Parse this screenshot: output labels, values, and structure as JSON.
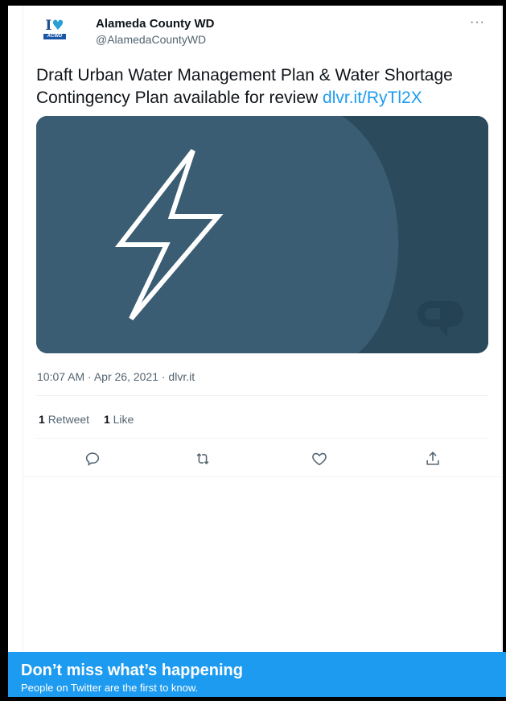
{
  "account": {
    "display_name": "Alameda County WD",
    "handle": "@AlamedaCountyWD",
    "avatar_text": "I",
    "avatar_bar_text": "ACWD"
  },
  "tweet": {
    "text": "Draft Urban Water Management Plan & Water Shortage Contingency Plan available for review ",
    "link": "dlvr.it/RyTl2X",
    "media_icon": "lightning-bolt-icon",
    "media_watermark": "link-preview-logo-icon",
    "timestamp": "10:07 AM · Apr 26, 2021 · dlvr.it"
  },
  "stats": {
    "retweets_count": "1",
    "retweets_label": "Retweet",
    "likes_count": "1",
    "likes_label": "Like"
  },
  "actions": {
    "reply_icon": "reply-icon",
    "retweet_icon": "retweet-icon",
    "like_icon": "heart-icon",
    "share_icon": "share-icon"
  },
  "more_menu": "···",
  "banner": {
    "title": "Don’t miss what’s happening",
    "subtitle": "People on Twitter are the first to know."
  },
  "colors": {
    "accent": "#1d9bf0",
    "media_bg": "#3a5d74",
    "media_dark": "#2b4a5c"
  }
}
